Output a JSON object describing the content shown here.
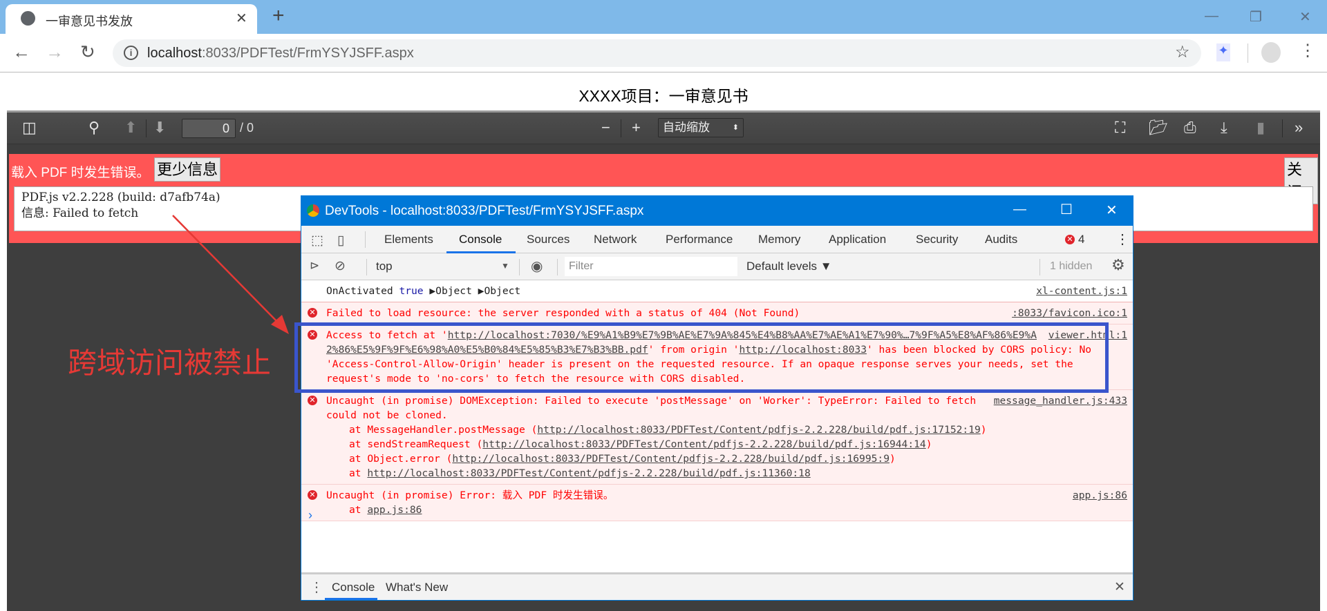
{
  "browser": {
    "tab_title": "一审意见书发放",
    "new_tab": "+",
    "url_host": "localhost",
    "url_rest": ":8033/PDFTest/FrmYSYJSFF.aspx"
  },
  "page": {
    "title": "XXXX项目：一审意见书"
  },
  "viewer": {
    "page_number": "0",
    "page_count": "/ 0",
    "zoom": "自动缩放",
    "error_message": "载入 PDF 时发生错误。",
    "less_info_button": "更少信息",
    "close_button": "关闭",
    "error_details": "PDF.js v2.2.228 (build: d7afb74a)\n信息: Failed to fetch"
  },
  "annotation": {
    "text": "跨域访问被禁止",
    "color": "#e53935",
    "highlight_color": "#3a55cc"
  },
  "devtools": {
    "title": "DevTools - localhost:8033/PDFTest/FrmYSYJSFF.aspx",
    "tabs": [
      "Elements",
      "Console",
      "Sources",
      "Network",
      "Performance",
      "Memory",
      "Application",
      "Security",
      "Audits"
    ],
    "active_tab": "Console",
    "error_count": "4",
    "context": "top",
    "filter_placeholder": "Filter",
    "levels": "Default levels ▼",
    "hidden": "1 hidden",
    "messages": [
      {
        "pre": "OnActivated ",
        "kw": "true",
        "post": " ▶Object ▶Object",
        "src": "xl-content.js:1"
      },
      {
        "text": "Failed to load resource: the server responded with a status of 404 (Not Found)",
        "src": ":8033/favicon.ico:1"
      },
      {
        "pre": "Access to fetch at '",
        "url": "http://localhost:7030/%E9%A1%B9%E7%9B%AE%E7%9A%845%E4%B8%AA%E7%AE%A1%E7%90%…7%9F%A5%E8%AF%86%E9%A2%86%E5%9F%9F%E6%98%A0%E5%B0%84%E5%85%B3%E7%B3%BB.pdf",
        "mid": "' from origin '",
        "origin": "http://localhost:8033",
        "post": "' has been blocked by CORS policy: No 'Access-Control-Allow-Origin' header is present on the requested resource. If an opaque response serves your needs, set the request's mode to 'no-cors' to fetch the resource with CORS disabled.",
        "src": "viewer.html:1"
      },
      {
        "text": "Uncaught (in promise) DOMException: Failed to execute 'postMessage' on 'Worker': TypeError: Failed to fetch could not be cloned.",
        "src": "message_handler.js:433",
        "stack": [
          {
            "pre": "at MessageHandler.postMessage (",
            "link": "http://localhost:8033/PDFTest/Content/pdfjs-2.2.228/build/pdf.js:17152:19",
            "post": ")"
          },
          {
            "pre": "at sendStreamRequest (",
            "link": "http://localhost:8033/PDFTest/Content/pdfjs-2.2.228/build/pdf.js:16944:14",
            "post": ")"
          },
          {
            "pre": "at Object.error (",
            "link": "http://localhost:8033/PDFTest/Content/pdfjs-2.2.228/build/pdf.js:16995:9",
            "post": ")"
          },
          {
            "pre": "at ",
            "link": "http://localhost:8033/PDFTest/Content/pdfjs-2.2.228/build/pdf.js:11360:18",
            "post": ""
          }
        ]
      },
      {
        "text": "Uncaught (in promise) Error: 载入 PDF 时发生错误。",
        "src": "app.js:86",
        "stack": [
          {
            "pre": "at ",
            "link": "app.js:86",
            "post": ""
          }
        ]
      }
    ],
    "drawer_tabs": [
      "Console",
      "What's New"
    ]
  }
}
